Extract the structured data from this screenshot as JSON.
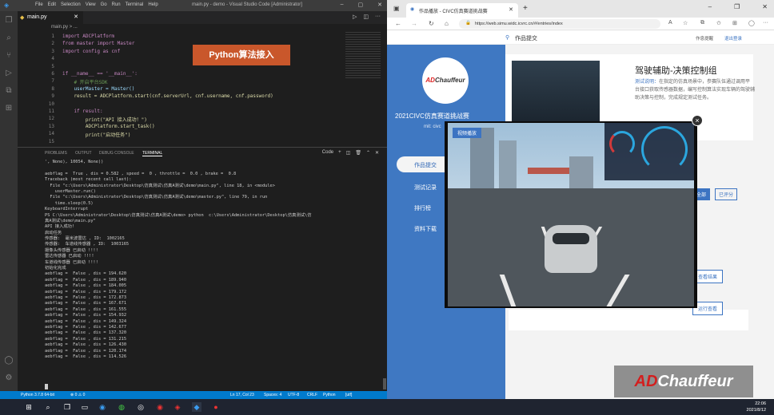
{
  "vscode": {
    "menu": [
      "File",
      "Edit",
      "Selection",
      "View",
      "Go",
      "Run",
      "Terminal",
      "Help"
    ],
    "title": "main.py - demo - Visual Studio Code [Administrator]",
    "tab": "main.py",
    "breadcrumb": "main.py > ...",
    "badge": "Python算法接入",
    "code_lines": [
      {
        "n": "1",
        "t": "import ADCPlatform"
      },
      {
        "n": "2",
        "t": "from master import Master"
      },
      {
        "n": "3",
        "t": "import config as cnf"
      },
      {
        "n": "4",
        "t": ""
      },
      {
        "n": "5",
        "t": ""
      },
      {
        "n": "6",
        "t": "if __name__ == '__main__':"
      },
      {
        "n": "7",
        "t": "    # 开启平台SDK"
      },
      {
        "n": "8",
        "t": "    userMaster = Master()"
      },
      {
        "n": "9",
        "t": "    result = ADCPlatform.start(cnf.serverUrl, cnf.username, cnf.password)"
      },
      {
        "n": "10",
        "t": ""
      },
      {
        "n": "11",
        "t": "    if result:"
      },
      {
        "n": "12",
        "t": "        print(\"API 接入成功！\")"
      },
      {
        "n": "13",
        "t": "        ADCPlatform.start_task()"
      },
      {
        "n": "14",
        "t": "        print(\"启动任务\")"
      },
      {
        "n": "15",
        "t": ""
      }
    ],
    "panel_tabs": [
      "PROBLEMS",
      "OUTPUT",
      "DEBUG CONSOLE",
      "TERMINAL"
    ],
    "panel_right": "Code",
    "terminal_lines": [
      "', None), 10054, None))",
      "",
      "aebflag =  True , dis = 0.582 , speed =  0 , throttle =  0.0 , brake =  0.8",
      "Traceback (most recent call last):",
      "  File \"c:\\Users\\Administrator\\Desktop\\仿真测试\\仿真A测试\\demo\\main.py\", line 18, in <module>",
      "    userMaster.run()",
      "  File \"c:\\Users\\Administrator\\Desktop\\仿真测试\\仿真A测试\\demo\\master.py\", line 79, in run",
      "    time.sleep(0.5)",
      "KeyboardInterrupt",
      "PS C:\\Users\\Administrator\\Desktop\\仿真测试\\仿真A测试\\demo> python  c:\\Users\\Administrator\\Desktop\\仿真测试\\仿",
      "真A测试\\demo\\main.py\"",
      "API 接入成功!",
      "启动任务",
      "传感器:  毫米波雷达 , ID:  1002165",
      "传感器:  车道线传感器 , ID:  1003165",
      "摄像头传感器 已启动 !!!!",
      "雷达传感器 已启动 !!!!",
      "车道线传感器 已启动 !!!!",
      "初始化完成",
      "aebflag =  False , dis = 194.620",
      "aebflag =  False , dis = 189.940",
      "aebflag =  False , dis = 184.005",
      "aebflag =  False , dis = 179.172",
      "aebflag =  False , dis = 172.873",
      "aebflag =  False , dis = 167.671",
      "aebflag =  False , dis = 161.555",
      "aebflag =  False , dis = 154.932",
      "aebflag =  False , dis = 149.324",
      "aebflag =  False , dis = 142.677",
      "aebflag =  False , dis = 137.320",
      "aebflag =  False , dis = 131.215",
      "aebflag =  False , dis = 126.430",
      "aebflag =  False , dis = 120.174",
      "aebflag =  False , dis = 114.526"
    ],
    "status": {
      "python": "Python 3.7.8 64-bit",
      "errors": "⊗ 0 ⚠ 0",
      "pos": "Ln 17, Col 23",
      "spaces": "Spaces: 4",
      "enc": "UTF-8",
      "eol": "CRLF",
      "lang": "Python",
      "sync": "[utf]"
    }
  },
  "browser": {
    "tab_title": "作品播放 - CIVC仿真赛道挑战赛",
    "url": "https://web.simu.widc.icvrc.cn/#/entries/index",
    "location": "作品提交",
    "head_links": [
      "作息提醒",
      "退出登录"
    ],
    "logo_text": "ADChauffeur",
    "event_title": "2021CIVC仿真赛道挑战赛",
    "event_sub": "mit: civc",
    "nav": [
      "作品提交",
      "测试记录",
      "排行榜",
      "资料下载"
    ],
    "card_title": "驾驶辅助-决策控制组",
    "card_desc_hl": "测试说明：",
    "card_desc": "在指定的仿真场景中，参赛队伍通过调用平台接口获取传感器数据，编写控制算法实现车辆的驾驶辅助决策与控制，完成规定测试任务。",
    "tags": [
      "全部",
      "已评分"
    ],
    "buttons": [
      "查看结果",
      "运行查看"
    ],
    "video_tag": "视频播放",
    "close": "×"
  },
  "watermark": {
    "a": "AD",
    "b": "Chauffeur"
  },
  "taskbar": {
    "time": "22:06",
    "date": "2021/8/12"
  }
}
